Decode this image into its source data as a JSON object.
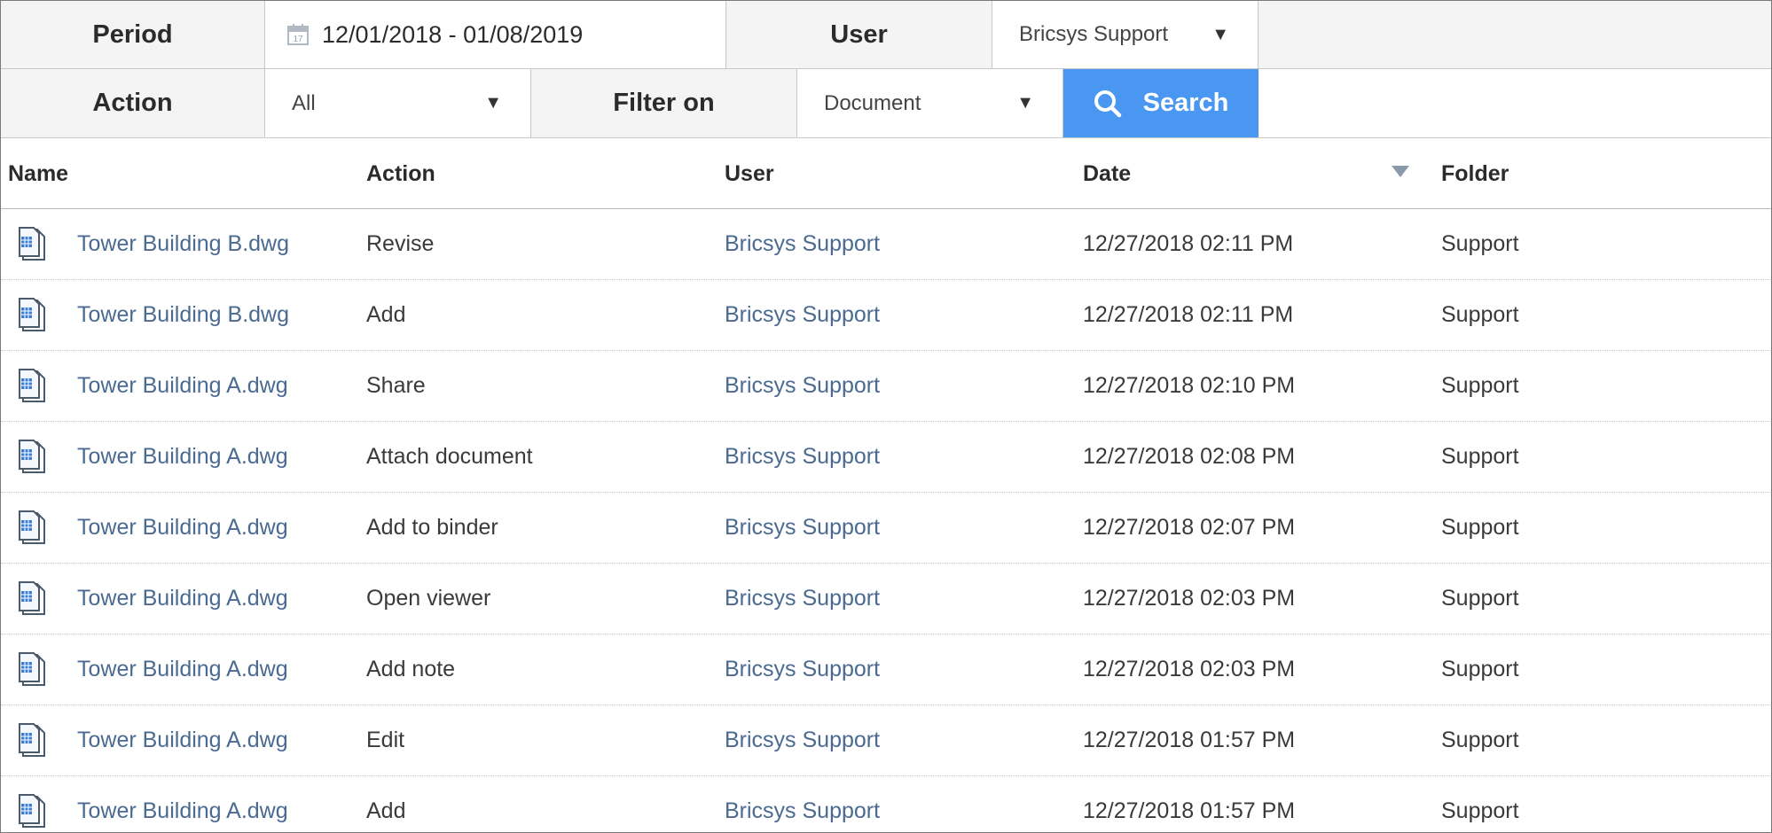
{
  "filters": {
    "period_label": "Period",
    "period_value": "12/01/2018 - 01/08/2019",
    "user_label": "User",
    "user_value": "Bricsys Support",
    "action_label": "Action",
    "action_value": "All",
    "filter_on_label": "Filter on",
    "filter_on_value": "Document",
    "search_label": "Search"
  },
  "table": {
    "columns": [
      "Name",
      "Action",
      "User",
      "Date",
      "Folder"
    ],
    "sorted_column": "Date",
    "rows": [
      {
        "name": "Tower Building B.dwg",
        "action": "Revise",
        "user": "Bricsys Support",
        "date": "12/27/2018 02:11 PM",
        "folder": "Support"
      },
      {
        "name": "Tower Building B.dwg",
        "action": "Add",
        "user": "Bricsys Support",
        "date": "12/27/2018 02:11 PM",
        "folder": "Support"
      },
      {
        "name": "Tower Building A.dwg",
        "action": "Share",
        "user": "Bricsys Support",
        "date": "12/27/2018 02:10 PM",
        "folder": "Support"
      },
      {
        "name": "Tower Building A.dwg",
        "action": "Attach document",
        "user": "Bricsys Support",
        "date": "12/27/2018 02:08 PM",
        "folder": "Support"
      },
      {
        "name": "Tower Building A.dwg",
        "action": "Add to binder",
        "user": "Bricsys Support",
        "date": "12/27/2018 02:07 PM",
        "folder": "Support"
      },
      {
        "name": "Tower Building A.dwg",
        "action": "Open viewer",
        "user": "Bricsys Support",
        "date": "12/27/2018 02:03 PM",
        "folder": "Support"
      },
      {
        "name": "Tower Building A.dwg",
        "action": "Add note",
        "user": "Bricsys Support",
        "date": "12/27/2018 02:03 PM",
        "folder": "Support"
      },
      {
        "name": "Tower Building A.dwg",
        "action": "Edit",
        "user": "Bricsys Support",
        "date": "12/27/2018 01:57 PM",
        "folder": "Support"
      },
      {
        "name": "Tower Building A.dwg",
        "action": "Add",
        "user": "Bricsys Support",
        "date": "12/27/2018 01:57 PM",
        "folder": "Support"
      }
    ]
  },
  "icons": {
    "calendar": "calendar-icon",
    "dropdown": "caret-down-icon",
    "search": "magnifier-icon",
    "sort": "sort-descending-icon",
    "file": "dwg-file-icon"
  },
  "colors": {
    "accent": "#4a97f2",
    "link": "#4a6a92",
    "label_bg": "#f4f4f4"
  }
}
